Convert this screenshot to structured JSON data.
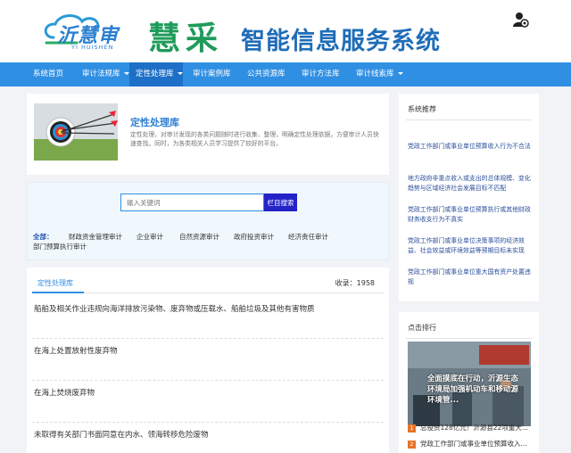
{
  "header": {
    "logo_text": "沂慧审",
    "logo_subtext": "YI HUISHEN",
    "brand": "慧采",
    "system_title": "智能信息服务系统",
    "user_icon": "user-gear-icon"
  },
  "nav": {
    "items": [
      {
        "label": "系统首页"
      },
      {
        "label": "审计法规库"
      },
      {
        "label": "定性处理库"
      },
      {
        "label": "审计案例库"
      },
      {
        "label": "公共资源库"
      },
      {
        "label": "审计方法库"
      },
      {
        "label": "审计线索库"
      }
    ],
    "active_index": 2
  },
  "intro": {
    "title": "定性处理库",
    "description": "定性处理，对审计发现的各类问题随时进行收集、整理，明确定性处理依据，方便审计人员快速查找。同时，为各类相关人员学习提供了较好的平台。"
  },
  "search": {
    "placeholder": "输入关键词",
    "button_label": "栏目搜索"
  },
  "categories": {
    "label": "全部：",
    "items": [
      "财政资金管理审计",
      "企业审计",
      "自然资源审计",
      "政府投资审计",
      "经济责任审计",
      "部门预算执行审计"
    ]
  },
  "list": {
    "tab_label": "定性处理库",
    "count_text": "收录：1958",
    "items": [
      "船舶及相关作业违规向海洋排放污染物、废弃物或压载水、船舶垃圾及其他有害物质",
      "在海上处置放射性废弃物",
      "在海上焚烧废弃物",
      "未取得有关部门书面同意在内水、领海转移危险废物"
    ]
  },
  "recommend": {
    "title": "系统推荐",
    "items": [
      "党政工作部门或事业单位预算收入行为不合法",
      "地方政府非重点收入或支出的总体规模、变化趋势与区域经济社会发展目标不匹配",
      "党政工作部门或事业单位预算执行或其他财政财务收支行为不真实",
      "党政工作部门或事业单位决策事项的经济效益、社会效益或环境效益等预期目标未实现",
      "党政工作部门或事业单位重大国有资产处置违规"
    ]
  },
  "hot": {
    "title": "点击排行",
    "image_caption": "全面摸底在行动，沂源生态环境局加强机动车和移动源环境管...",
    "items": [
      {
        "rank": "1",
        "text": "总投资128亿元！沂源县22项重大..."
      },
      {
        "rank": "2",
        "text": "党政工作部门或事业单位预算收入..."
      }
    ]
  },
  "colors": {
    "nav_bg": "#2f8fe3",
    "nav_active": "#1d6fc7",
    "brand_green": "#1e9b5a",
    "title_blue": "#1f6db7",
    "search_button": "#2323c8",
    "rank_badge": "#e8742a"
  }
}
